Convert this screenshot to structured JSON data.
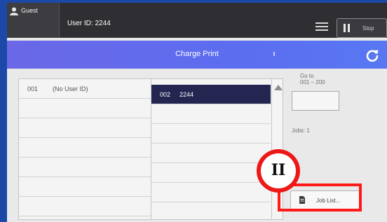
{
  "status_bar": {
    "guest_label": "Guest",
    "user_id": "User ID: 2244",
    "menu_icon": "hamburger-menu-icon",
    "stop_label": "Stop"
  },
  "title_bar": {
    "title": "Charge Print",
    "refresh_icon": "refresh-icon"
  },
  "user_list": {
    "left_column": [
      {
        "num": "001",
        "value": "(No User ID)"
      }
    ],
    "right_column": [
      {
        "num": "002",
        "value": "2244",
        "selected": true
      }
    ]
  },
  "side_panel": {
    "goto_label": "Go to",
    "goto_range": "001 – 200",
    "goto_value": "",
    "jobs_label": "Jobs: 1",
    "job_list_label": "Job List..."
  },
  "annotation": {
    "marker_label": "II",
    "highlight_color": "#ff1a1a"
  },
  "colors": {
    "title_bar": "#5c6df0",
    "selected_row": "#252551"
  }
}
